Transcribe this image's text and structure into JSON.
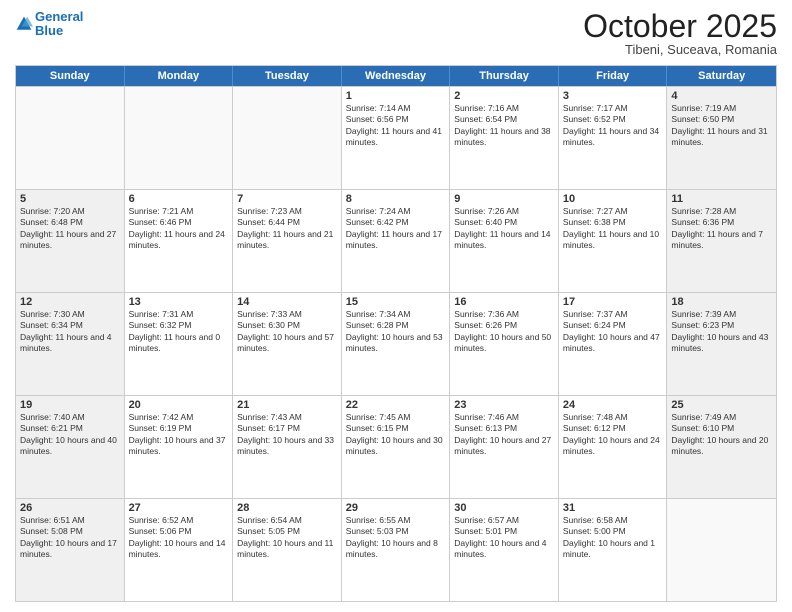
{
  "header": {
    "logo_line1": "General",
    "logo_line2": "Blue",
    "month": "October 2025",
    "location": "Tibeni, Suceava, Romania"
  },
  "days_of_week": [
    "Sunday",
    "Monday",
    "Tuesday",
    "Wednesday",
    "Thursday",
    "Friday",
    "Saturday"
  ],
  "weeks": [
    [
      {
        "day": "",
        "text": "",
        "empty": true
      },
      {
        "day": "",
        "text": "",
        "empty": true
      },
      {
        "day": "",
        "text": "",
        "empty": true
      },
      {
        "day": "1",
        "text": "Sunrise: 7:14 AM\nSunset: 6:56 PM\nDaylight: 11 hours and 41 minutes.",
        "empty": false
      },
      {
        "day": "2",
        "text": "Sunrise: 7:16 AM\nSunset: 6:54 PM\nDaylight: 11 hours and 38 minutes.",
        "empty": false
      },
      {
        "day": "3",
        "text": "Sunrise: 7:17 AM\nSunset: 6:52 PM\nDaylight: 11 hours and 34 minutes.",
        "empty": false
      },
      {
        "day": "4",
        "text": "Sunrise: 7:19 AM\nSunset: 6:50 PM\nDaylight: 11 hours and 31 minutes.",
        "empty": false
      }
    ],
    [
      {
        "day": "5",
        "text": "Sunrise: 7:20 AM\nSunset: 6:48 PM\nDaylight: 11 hours and 27 minutes.",
        "empty": false
      },
      {
        "day": "6",
        "text": "Sunrise: 7:21 AM\nSunset: 6:46 PM\nDaylight: 11 hours and 24 minutes.",
        "empty": false
      },
      {
        "day": "7",
        "text": "Sunrise: 7:23 AM\nSunset: 6:44 PM\nDaylight: 11 hours and 21 minutes.",
        "empty": false
      },
      {
        "day": "8",
        "text": "Sunrise: 7:24 AM\nSunset: 6:42 PM\nDaylight: 11 hours and 17 minutes.",
        "empty": false
      },
      {
        "day": "9",
        "text": "Sunrise: 7:26 AM\nSunset: 6:40 PM\nDaylight: 11 hours and 14 minutes.",
        "empty": false
      },
      {
        "day": "10",
        "text": "Sunrise: 7:27 AM\nSunset: 6:38 PM\nDaylight: 11 hours and 10 minutes.",
        "empty": false
      },
      {
        "day": "11",
        "text": "Sunrise: 7:28 AM\nSunset: 6:36 PM\nDaylight: 11 hours and 7 minutes.",
        "empty": false
      }
    ],
    [
      {
        "day": "12",
        "text": "Sunrise: 7:30 AM\nSunset: 6:34 PM\nDaylight: 11 hours and 4 minutes.",
        "empty": false
      },
      {
        "day": "13",
        "text": "Sunrise: 7:31 AM\nSunset: 6:32 PM\nDaylight: 11 hours and 0 minutes.",
        "empty": false
      },
      {
        "day": "14",
        "text": "Sunrise: 7:33 AM\nSunset: 6:30 PM\nDaylight: 10 hours and 57 minutes.",
        "empty": false
      },
      {
        "day": "15",
        "text": "Sunrise: 7:34 AM\nSunset: 6:28 PM\nDaylight: 10 hours and 53 minutes.",
        "empty": false
      },
      {
        "day": "16",
        "text": "Sunrise: 7:36 AM\nSunset: 6:26 PM\nDaylight: 10 hours and 50 minutes.",
        "empty": false
      },
      {
        "day": "17",
        "text": "Sunrise: 7:37 AM\nSunset: 6:24 PM\nDaylight: 10 hours and 47 minutes.",
        "empty": false
      },
      {
        "day": "18",
        "text": "Sunrise: 7:39 AM\nSunset: 6:23 PM\nDaylight: 10 hours and 43 minutes.",
        "empty": false
      }
    ],
    [
      {
        "day": "19",
        "text": "Sunrise: 7:40 AM\nSunset: 6:21 PM\nDaylight: 10 hours and 40 minutes.",
        "empty": false
      },
      {
        "day": "20",
        "text": "Sunrise: 7:42 AM\nSunset: 6:19 PM\nDaylight: 10 hours and 37 minutes.",
        "empty": false
      },
      {
        "day": "21",
        "text": "Sunrise: 7:43 AM\nSunset: 6:17 PM\nDaylight: 10 hours and 33 minutes.",
        "empty": false
      },
      {
        "day": "22",
        "text": "Sunrise: 7:45 AM\nSunset: 6:15 PM\nDaylight: 10 hours and 30 minutes.",
        "empty": false
      },
      {
        "day": "23",
        "text": "Sunrise: 7:46 AM\nSunset: 6:13 PM\nDaylight: 10 hours and 27 minutes.",
        "empty": false
      },
      {
        "day": "24",
        "text": "Sunrise: 7:48 AM\nSunset: 6:12 PM\nDaylight: 10 hours and 24 minutes.",
        "empty": false
      },
      {
        "day": "25",
        "text": "Sunrise: 7:49 AM\nSunset: 6:10 PM\nDaylight: 10 hours and 20 minutes.",
        "empty": false
      }
    ],
    [
      {
        "day": "26",
        "text": "Sunrise: 6:51 AM\nSunset: 5:08 PM\nDaylight: 10 hours and 17 minutes.",
        "empty": false
      },
      {
        "day": "27",
        "text": "Sunrise: 6:52 AM\nSunset: 5:06 PM\nDaylight: 10 hours and 14 minutes.",
        "empty": false
      },
      {
        "day": "28",
        "text": "Sunrise: 6:54 AM\nSunset: 5:05 PM\nDaylight: 10 hours and 11 minutes.",
        "empty": false
      },
      {
        "day": "29",
        "text": "Sunrise: 6:55 AM\nSunset: 5:03 PM\nDaylight: 10 hours and 8 minutes.",
        "empty": false
      },
      {
        "day": "30",
        "text": "Sunrise: 6:57 AM\nSunset: 5:01 PM\nDaylight: 10 hours and 4 minutes.",
        "empty": false
      },
      {
        "day": "31",
        "text": "Sunrise: 6:58 AM\nSunset: 5:00 PM\nDaylight: 10 hours and 1 minute.",
        "empty": false
      },
      {
        "day": "",
        "text": "",
        "empty": true
      }
    ]
  ]
}
